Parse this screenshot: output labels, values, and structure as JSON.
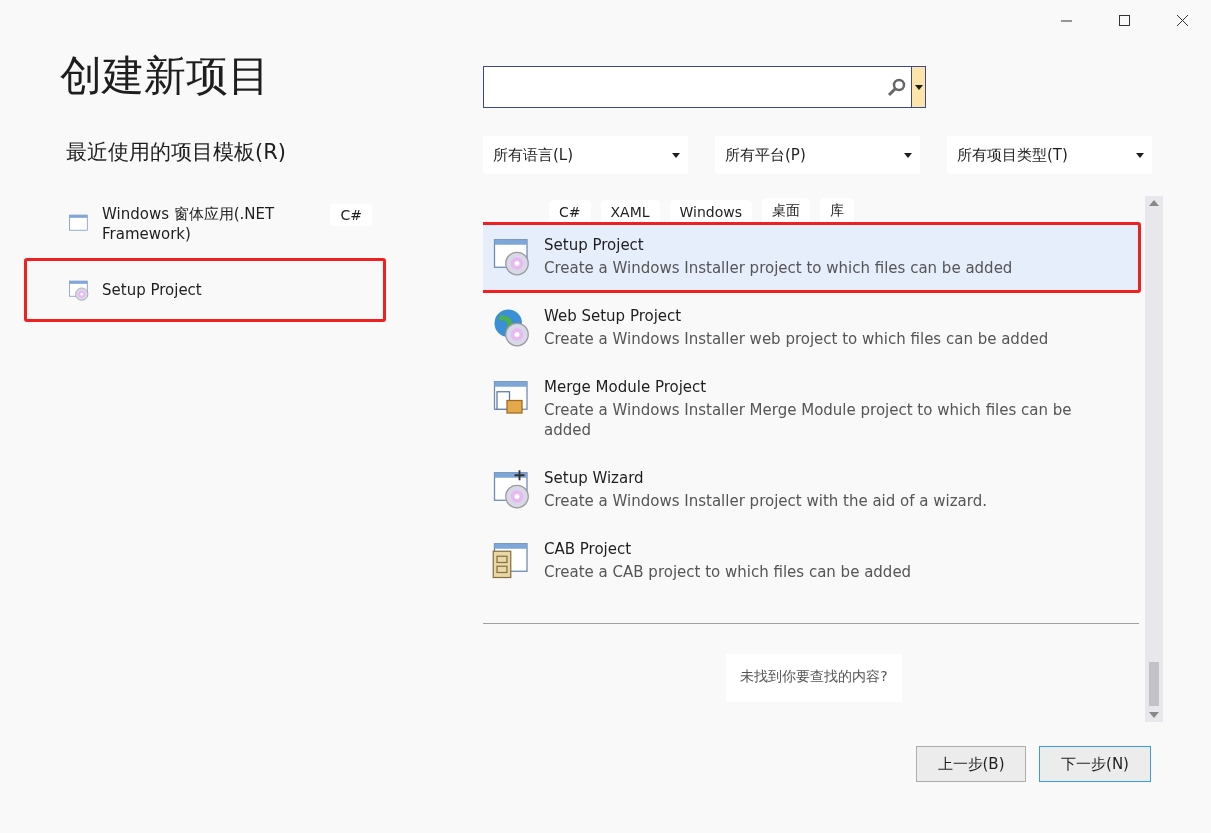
{
  "window": {
    "controls": [
      {
        "kind": "minimize"
      },
      {
        "kind": "maximize"
      },
      {
        "kind": "close"
      }
    ]
  },
  "title": "创建新项目",
  "recent": {
    "heading": "最近使用的项目模板(R)",
    "items": [
      {
        "name": "Windows 窗体应用(.NET Framework)",
        "kind": "form",
        "tag": "C#",
        "annotated": false
      },
      {
        "name": "Setup Project",
        "kind": "setup",
        "annotated": true
      }
    ]
  },
  "filters": [
    {
      "label": "所有语言(L)"
    },
    {
      "label": "所有平台(P)"
    },
    {
      "label": "所有项目类型(T)"
    }
  ],
  "tags": [
    "C#",
    "XAML",
    "Windows",
    "桌面",
    "库"
  ],
  "templates": [
    {
      "name": "Setup Project",
      "description": "Create a Windows Installer project to which files can be added",
      "kind": "setup",
      "selected": true,
      "annotated": true
    },
    {
      "name": "Web Setup Project",
      "description": "Create a Windows Installer web project to which files can be added",
      "kind": "web",
      "selected": false,
      "annotated": false
    },
    {
      "name": "Merge Module Project",
      "description": "Create a Windows Installer Merge Module project to which files can be added",
      "kind": "merge",
      "selected": false,
      "annotated": false
    },
    {
      "name": "Setup Wizard",
      "description": "Create a Windows Installer project with the aid of a wizard.",
      "kind": "wizard",
      "selected": false,
      "annotated": false
    },
    {
      "name": "CAB Project",
      "description": "Create a CAB project to which files can be added",
      "kind": "cab",
      "selected": false,
      "annotated": false
    }
  ],
  "not_found": "未找到你要查找的内容?",
  "buttons": [
    {
      "label": "上一步(B)",
      "primary": false
    },
    {
      "label": "下一步(N)",
      "primary": true
    }
  ]
}
